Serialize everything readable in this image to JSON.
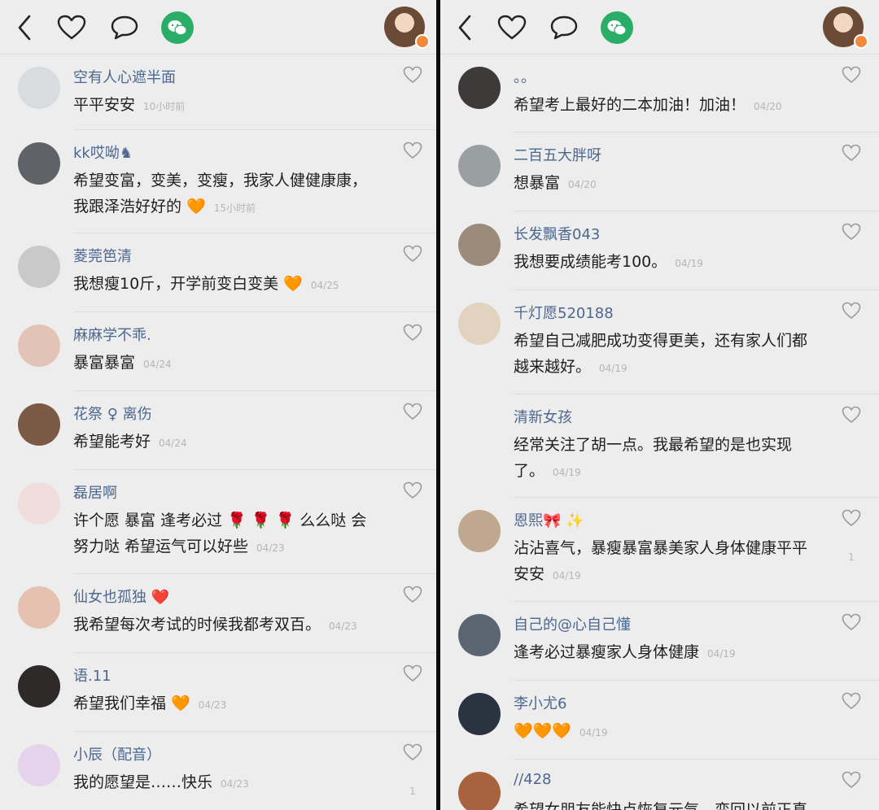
{
  "left": {
    "comments": [
      {
        "name": "空有人心遮半面",
        "text": "平平安安",
        "time": "10小时前",
        "avatar_color": "#d9dcdf",
        "likes": ""
      },
      {
        "name": "kk哎呦♞",
        "text": "希望变富，变美，变瘦，我家人健健康康，我跟泽浩好好的 🧡",
        "time": "15小时前",
        "avatar_color": "#5f6368",
        "likes": ""
      },
      {
        "name": "菱莞笆清",
        "text": "我想瘦10斤，开学前变白变美 🧡",
        "time": "04/25",
        "avatar_color": "#c9c9c9",
        "likes": ""
      },
      {
        "name": "麻麻学不乖.",
        "text": "暴富暴富",
        "time": "04/24",
        "avatar_color": "#e3c3b6",
        "likes": ""
      },
      {
        "name": "花祭 ♀ 离伤",
        "text": "希望能考好",
        "time": "04/24",
        "avatar_color": "#7a5a45",
        "likes": ""
      },
      {
        "name": "磊居啊",
        "text": "许个愿 暴富 逢考必过 🌹 🌹 🌹 么么哒 会努力哒 希望运气可以好些",
        "time": "04/23",
        "avatar_color": "#f0dede",
        "likes": ""
      },
      {
        "name": "仙女也孤独 ❤️",
        "text": "我希望每次考试的时候我都考双百。",
        "time": "04/23",
        "avatar_color": "#e6c0b0",
        "likes": ""
      },
      {
        "name": "语.11",
        "text": "希望我们幸福 🧡",
        "time": "04/23",
        "avatar_color": "#2f2a2a",
        "likes": ""
      },
      {
        "name": "小辰（配音）",
        "text": "我的愿望是……快乐",
        "time": "04/23",
        "avatar_color": "#e4d3ea",
        "likes": "1"
      }
    ]
  },
  "right": {
    "comments": [
      {
        "name": "。。",
        "text": "希望考上最好的二本加油！加油！",
        "time": "04/20",
        "avatar_color": "#3e3a3a",
        "likes": ""
      },
      {
        "name": "二百五大胖呀",
        "text": "想暴富",
        "time": "04/20",
        "avatar_color": "#9aa0a2",
        "likes": ""
      },
      {
        "name": "长发飘香043",
        "text": "我想要成绩能考100。",
        "time": "04/19",
        "avatar_color": "#9b8b7b",
        "likes": ""
      },
      {
        "name": "千灯愿520188",
        "text": "希望自己减肥成功变得更美，还有家人们都越来越好。",
        "time": "04/19",
        "avatar_color": "#e2d3c0",
        "likes": ""
      },
      {
        "name": "清新女孩",
        "text": "经常关注了胡一点。我最希望的是也实现了。",
        "time": "04/19",
        "avatar_color": "#efeeee",
        "likes": ""
      },
      {
        "name": "恩熙🎀 ✨",
        "text": "沾沾喜气，暴瘦暴富暴美家人身体健康平平安安",
        "time": "04/19",
        "avatar_color": "#c0a890",
        "likes": "1"
      },
      {
        "name": "自己的@心自己懂",
        "text": "逢考必过暴瘦家人身体健康",
        "time": "04/19",
        "avatar_color": "#5c6673",
        "likes": ""
      },
      {
        "name": "李小尤6",
        "text": "🧡🧡🧡",
        "time": "04/19",
        "avatar_color": "#2a3440",
        "likes": ""
      },
      {
        "name": "//428",
        "text": "希望女朋友能快点恢复元气，变回以前正真",
        "time": "",
        "avatar_color": "#a8623e",
        "likes": ""
      }
    ]
  },
  "icons": {
    "back": "back-arrow-icon",
    "like": "heart-icon",
    "comment": "comment-bubble-icon",
    "share": "wechat-icon",
    "badge_color": "#f08a3c",
    "wechat_green": "#2aad67",
    "name_color": "#4c6790"
  }
}
